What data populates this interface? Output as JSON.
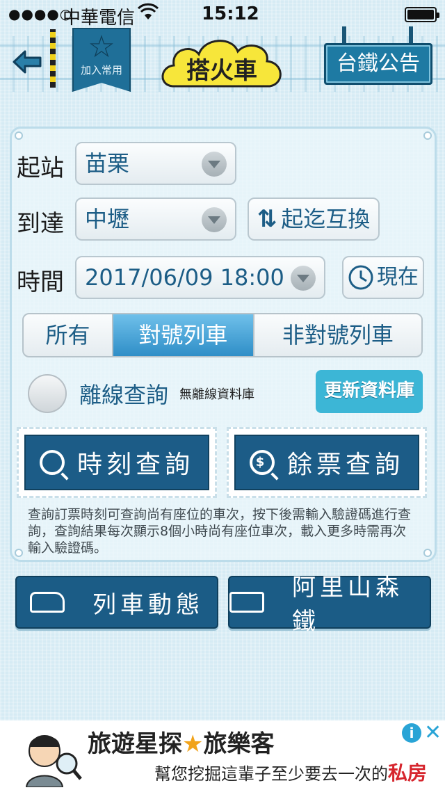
{
  "status_bar": {
    "signal": "●●●●○",
    "carrier": "中華電信",
    "time": "15:12"
  },
  "header": {
    "favorite_label": "加入常用",
    "title": "搭火車",
    "notice_button": "台鐵公告"
  },
  "form": {
    "from_label": "起站",
    "from_value": "苗栗",
    "to_label": "到達",
    "to_value": "中壢",
    "swap_button": "起迄互換",
    "time_label": "時間",
    "time_value": "2017/06/09 18:00",
    "now_button": "現在",
    "segments": [
      "所有",
      "對號列車",
      "非對號列車"
    ],
    "active_segment": "對號列車",
    "offline_label": "離線查詢",
    "offline_status": "無離線資料庫",
    "update_button": "更新資料庫",
    "timetable_button": "時刻查詢",
    "ticket_button": "餘票查詢",
    "note": "查詢訂票時刻可查詢尚有座位的車次，按下後需輸入驗證碼進行查詢，查詢結果每次顯示8個小時尚有座位車次，載入更多時需再次輸入驗證碼。"
  },
  "bottom": {
    "train_status_button": "列車動態",
    "alishan_button": "阿里山森鐵"
  },
  "ad": {
    "headline_a": "旅遊星探",
    "headline_star": "★",
    "headline_b": "旅樂客",
    "sub_a": "幫您挖掘這輩子至少要去一次的",
    "sub_b": "私房秘境",
    "info": "i",
    "close": "✕"
  },
  "colors": {
    "primary_dark": "#1c5c87",
    "accent": "#3cb6d6",
    "active_segment": "#2f8ec7",
    "background": "#d6ebf4"
  },
  "icons": [
    "back-arrow-icon",
    "star-icon",
    "wifi-icon",
    "battery-icon",
    "swap-icon",
    "clock-icon",
    "search-icon",
    "dollar-search-icon",
    "train-icon",
    "alishan-train-icon"
  ]
}
